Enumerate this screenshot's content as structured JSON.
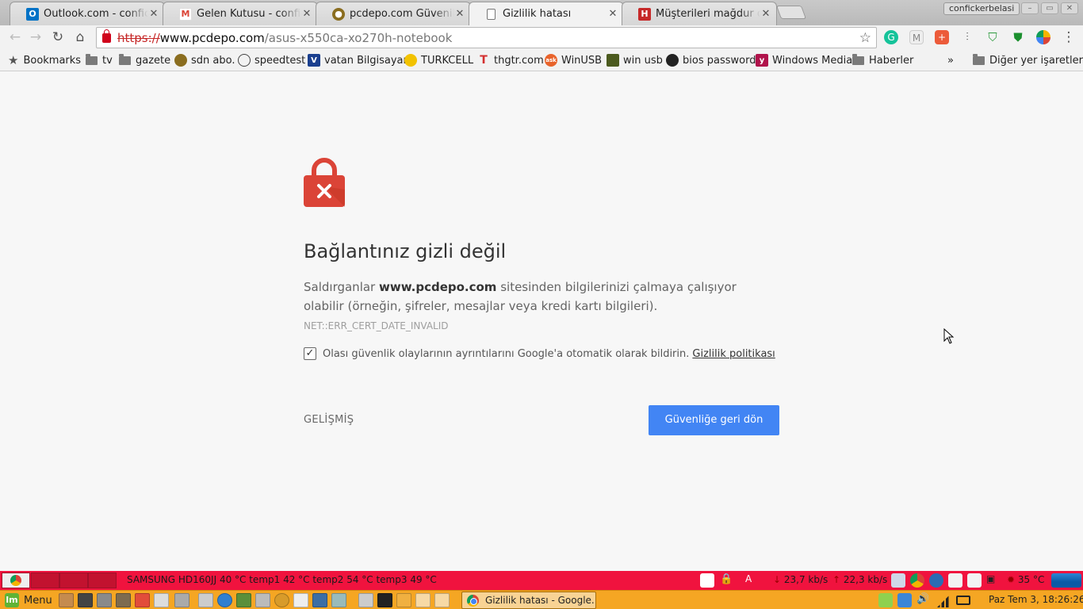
{
  "tabs": [
    {
      "title": "Outlook.com - conficker",
      "favicon": "outlook-icon",
      "color": "#0072c6"
    },
    {
      "title": "Gelen Kutusu - conficker",
      "favicon": "gmail-icon",
      "color": "#db4437"
    },
    {
      "title": "pcdepo.com Güvenilir M",
      "favicon": "pcdepo-icon",
      "color": "#8a6d1f"
    },
    {
      "title": "Gizlilik hatası",
      "favicon": "page-icon",
      "color": "#666666"
    },
    {
      "title": "Müşterileri mağdur olar",
      "favicon": "h-icon",
      "color": "#c62828"
    }
  ],
  "profile_name": "confickerbelasi",
  "address": {
    "scheme": "https://",
    "host": "www.pcdepo.com",
    "path": "/asus-x550ca-xo270h-notebook"
  },
  "bookmarks": [
    {
      "label": "Bookmarks",
      "type": "star"
    },
    {
      "label": "tv",
      "type": "folder"
    },
    {
      "label": "gazete",
      "type": "folder"
    },
    {
      "label": "sdn abo.",
      "type": "site",
      "color": "#8a6d1f"
    },
    {
      "label": "speedtest",
      "type": "site",
      "color": "#444444"
    },
    {
      "label": "vatan Bilgisayar",
      "type": "site",
      "color": "#1a3f8f"
    },
    {
      "label": "TURKCELL",
      "type": "site",
      "color": "#f2c200"
    },
    {
      "label": "thgtr.com",
      "type": "site",
      "color": "#d32f2f"
    },
    {
      "label": "WinUSB",
      "type": "site",
      "color": "#e8632b"
    },
    {
      "label": "win usb",
      "type": "site",
      "color": "#4b5a1e"
    },
    {
      "label": "bios password",
      "type": "site",
      "color": "#222222"
    },
    {
      "label": "Windows Media",
      "type": "site",
      "color": "#b0134b"
    },
    {
      "label": "Haberler",
      "type": "folder"
    }
  ],
  "bookmarks_overflow": "»",
  "other_bookmarks": "Diğer yer işaretleri",
  "interstitial": {
    "heading": "Bağlantınız gizli değil",
    "explain_prefix": "Saldırganlar",
    "explain_host": "www.pcdepo.com",
    "explain_suffix": "sitesinden bilgilerinizi çalmaya çalışıyor olabilir (örneğin, şifreler, mesajlar veya kredi kartı bilgileri).",
    "error_code": "NET::ERR_CERT_DATE_INVALID",
    "report_checked": true,
    "report_text": "Olası güvenlik olaylarının ayrıntılarını Google'a otomatik olarak bildirin.",
    "privacy_link": "Gizlilik politikası",
    "advanced": "GELİŞMİŞ",
    "back_button": "Güvenliğe geri dön",
    "accent": "#4285f4",
    "icon_color": "#db4437"
  },
  "panel_top": {
    "sensors": "SAMSUNG HD160JJ 40 °C temp1 42 °C temp2 54 °C temp3 49 °C",
    "download": "23,7 kb/s",
    "upload": "22,3 kb/s",
    "cpu_temp": "35 °C",
    "color": "#f0133e"
  },
  "panel_bottom": {
    "menu_label": "Menu",
    "task_title": "Gizlilik hatası - Google...",
    "clock": "Paz Tem  3, 18:26:26",
    "color": "#f5a623"
  }
}
